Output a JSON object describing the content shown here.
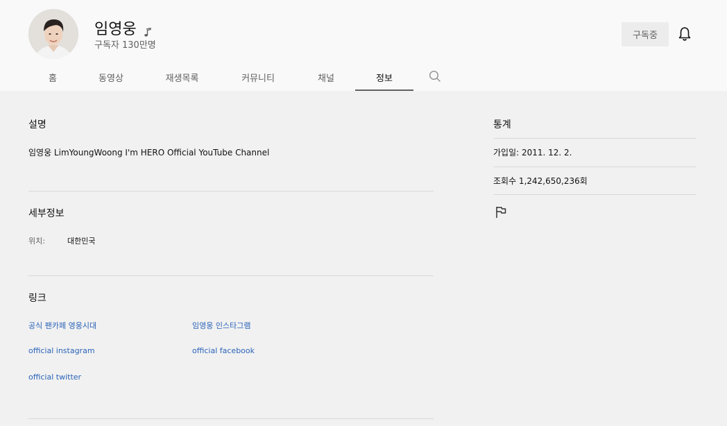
{
  "channel": {
    "name": "임영웅",
    "subscribers": "구독자 130만명"
  },
  "header": {
    "subscribe_label": "구독중"
  },
  "tabs": [
    {
      "label": "홈"
    },
    {
      "label": "동영상"
    },
    {
      "label": "재생목록"
    },
    {
      "label": "커뮤니티"
    },
    {
      "label": "채널"
    },
    {
      "label": "정보",
      "active": true
    }
  ],
  "about": {
    "description_title": "설명",
    "description": "임영웅 LimYoungWoong I'm HERO Official YouTube Channel",
    "details_title": "세부정보",
    "location_label": "위치:",
    "location_value": "대한민국",
    "links_title": "링크",
    "links": [
      {
        "label": "공식 팬카페 영웅시대"
      },
      {
        "label": "임영웅 인스타그램"
      },
      {
        "label": "official instagram"
      },
      {
        "label": "official facebook"
      },
      {
        "label": "official twitter"
      }
    ]
  },
  "stats": {
    "title": "통계",
    "joined": "가입일: 2011. 12. 2.",
    "views": "조회수 1,242,650,236회"
  },
  "icons": {
    "note": "music-note-icon",
    "bell": "bell-icon",
    "search": "search-icon",
    "flag": "flag-icon"
  },
  "colors": {
    "link": "#2a63b8",
    "background": "#f1f1f1",
    "header_background": "#f9f9f9"
  }
}
